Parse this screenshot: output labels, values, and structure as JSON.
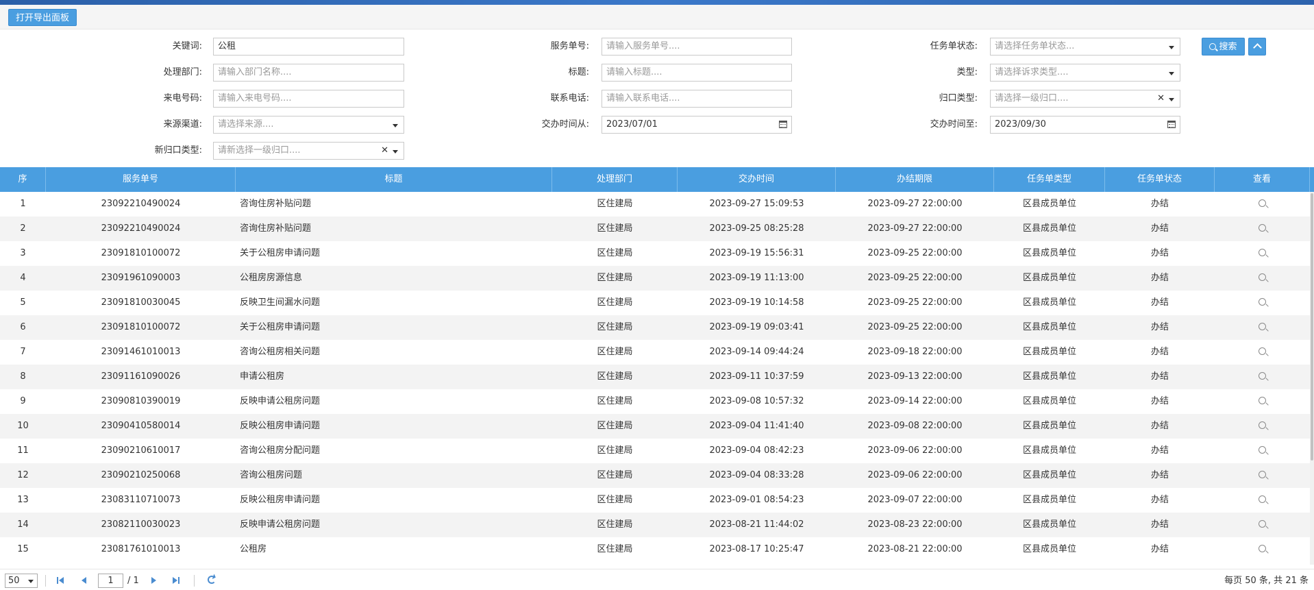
{
  "toolbar": {
    "export_label": "打开导出面板"
  },
  "filters": {
    "keyword": {
      "label": "关键词:",
      "value": "公租"
    },
    "service_no": {
      "label": "服务单号:",
      "placeholder": "请输入服务单号...."
    },
    "task_status": {
      "label": "任务单状态:",
      "placeholder": "请选择任务单状态..."
    },
    "dept": {
      "label": "处理部门:",
      "placeholder": "请输入部门名称...."
    },
    "title": {
      "label": "标题:",
      "placeholder": "请输入标题...."
    },
    "type": {
      "label": "类型:",
      "placeholder": "请选择诉求类型...."
    },
    "caller": {
      "label": "来电号码:",
      "placeholder": "请输入来电号码...."
    },
    "phone": {
      "label": "联系电话:",
      "placeholder": "请输入联系电话...."
    },
    "category": {
      "label": "归口类型:",
      "placeholder": "请选择一级归口...."
    },
    "source": {
      "label": "来源渠道:",
      "placeholder": "请选择来源...."
    },
    "date_from": {
      "label": "交办时间从:",
      "value": "2023/07/01"
    },
    "date_to": {
      "label": "交办时间至:",
      "value": "2023/09/30"
    },
    "new_category": {
      "label": "新归口类型:",
      "placeholder": "请新选择一级归口...."
    },
    "search_label": "搜索"
  },
  "table": {
    "headers": [
      "序",
      "服务单号",
      "标题",
      "处理部门",
      "交办时间",
      "办结期限",
      "任务单类型",
      "任务单状态",
      "查看"
    ],
    "rows": [
      [
        "1",
        "23092210490024",
        "咨询住房补贴问题",
        "区住建局",
        "2023-09-27 15:09:53",
        "2023-09-27 22:00:00",
        "区县成员单位",
        "办结"
      ],
      [
        "2",
        "23092210490024",
        "咨询住房补贴问题",
        "区住建局",
        "2023-09-25 08:25:28",
        "2023-09-27 22:00:00",
        "区县成员单位",
        "办结"
      ],
      [
        "3",
        "23091810100072",
        "关于公租房申请问题",
        "区住建局",
        "2023-09-19 15:56:31",
        "2023-09-25 22:00:00",
        "区县成员单位",
        "办结"
      ],
      [
        "4",
        "23091961090003",
        "公租房房源信息",
        "区住建局",
        "2023-09-19 11:13:00",
        "2023-09-25 22:00:00",
        "区县成员单位",
        "办结"
      ],
      [
        "5",
        "23091810030045",
        "反映卫生间漏水问题",
        "区住建局",
        "2023-09-19 10:14:58",
        "2023-09-25 22:00:00",
        "区县成员单位",
        "办结"
      ],
      [
        "6",
        "23091810100072",
        "关于公租房申请问题",
        "区住建局",
        "2023-09-19 09:03:41",
        "2023-09-25 22:00:00",
        "区县成员单位",
        "办结"
      ],
      [
        "7",
        "23091461010013",
        "咨询公租房相关问题",
        "区住建局",
        "2023-09-14 09:44:24",
        "2023-09-18 22:00:00",
        "区县成员单位",
        "办结"
      ],
      [
        "8",
        "23091161090026",
        "申请公租房",
        "区住建局",
        "2023-09-11 10:37:59",
        "2023-09-13 22:00:00",
        "区县成员单位",
        "办结"
      ],
      [
        "9",
        "23090810390019",
        "反映申请公租房问题",
        "区住建局",
        "2023-09-08 10:57:32",
        "2023-09-14 22:00:00",
        "区县成员单位",
        "办结"
      ],
      [
        "10",
        "23090410580014",
        "反映公租房申请问题",
        "区住建局",
        "2023-09-04 11:41:40",
        "2023-09-08 22:00:00",
        "区县成员单位",
        "办结"
      ],
      [
        "11",
        "23090210610017",
        "咨询公租房分配问题",
        "区住建局",
        "2023-09-04 08:42:23",
        "2023-09-06 22:00:00",
        "区县成员单位",
        "办结"
      ],
      [
        "12",
        "23090210250068",
        "咨询公租房问题",
        "区住建局",
        "2023-09-04 08:33:28",
        "2023-09-06 22:00:00",
        "区县成员单位",
        "办结"
      ],
      [
        "13",
        "23083110710073",
        "反映公租房申请问题",
        "区住建局",
        "2023-09-01 08:54:23",
        "2023-09-07 22:00:00",
        "区县成员单位",
        "办结"
      ],
      [
        "14",
        "23082110030023",
        "反映申请公租房问题",
        "区住建局",
        "2023-08-21 11:44:02",
        "2023-08-23 22:00:00",
        "区县成员单位",
        "办结"
      ],
      [
        "15",
        "23081761010013",
        "公租房",
        "区住建局",
        "2023-08-17 10:25:47",
        "2023-08-21 22:00:00",
        "区县成员单位",
        "办结"
      ]
    ]
  },
  "pager": {
    "page_size": "50",
    "page": "1",
    "total_pages": "/ 1",
    "info": "每页 50 条, 共 21 条"
  },
  "colors": {
    "accent": "#4a9ee0",
    "alt_row": "#f3f3f3",
    "header_text": "#ffffff"
  }
}
